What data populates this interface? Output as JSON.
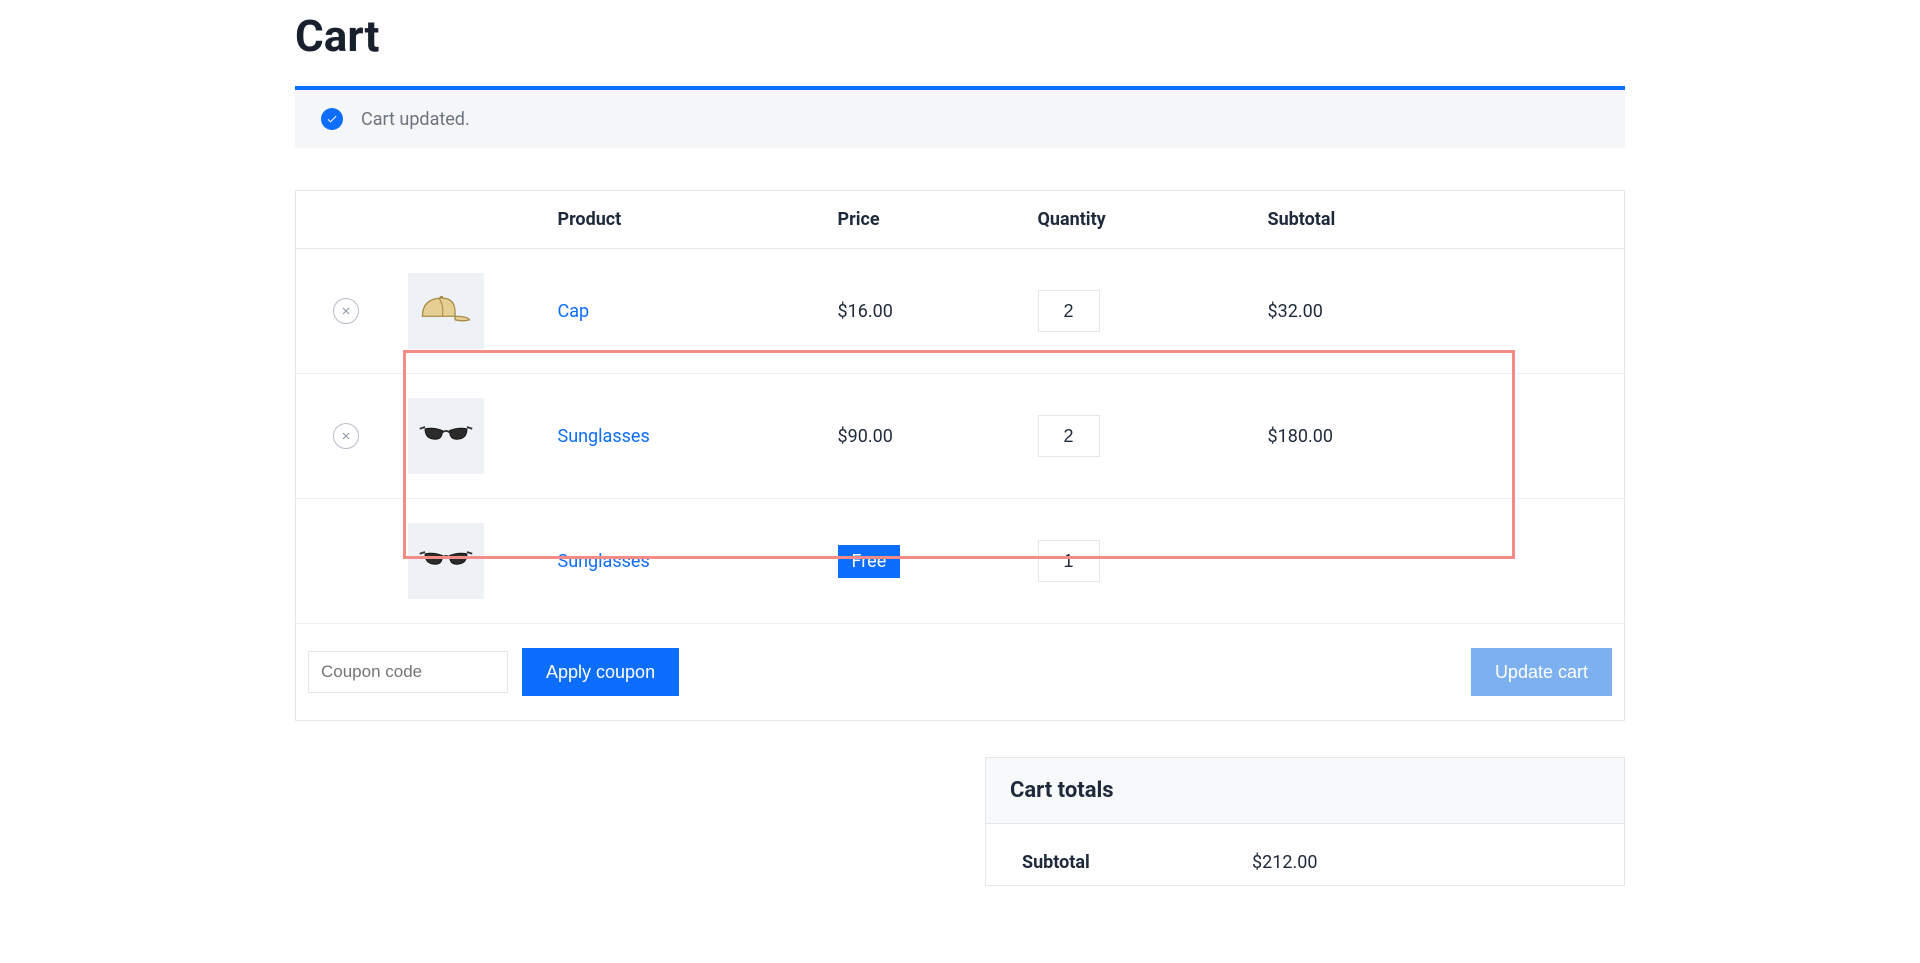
{
  "title": "Cart",
  "notice": {
    "message": "Cart updated."
  },
  "columns": {
    "product": "Product",
    "price": "Price",
    "quantity": "Quantity",
    "subtotal": "Subtotal"
  },
  "items": [
    {
      "name": "Cap",
      "price": "$16.00",
      "qty": "2",
      "subtotal": "$32.00",
      "removable": true,
      "thumb": "cap",
      "free": false
    },
    {
      "name": "Sunglasses",
      "price": "$90.00",
      "qty": "2",
      "subtotal": "$180.00",
      "removable": true,
      "thumb": "sunglasses",
      "free": false
    },
    {
      "name": "Sunglasses",
      "price": "",
      "qty": "1",
      "subtotal": "",
      "removable": false,
      "thumb": "sunglasses",
      "free": true
    }
  ],
  "free_label": "Free",
  "coupon": {
    "placeholder": "Coupon code",
    "apply_label": "Apply coupon"
  },
  "update_cart_label": "Update cart",
  "totals": {
    "heading": "Cart totals",
    "subtotal_label": "Subtotal",
    "subtotal_value": "$212.00"
  }
}
